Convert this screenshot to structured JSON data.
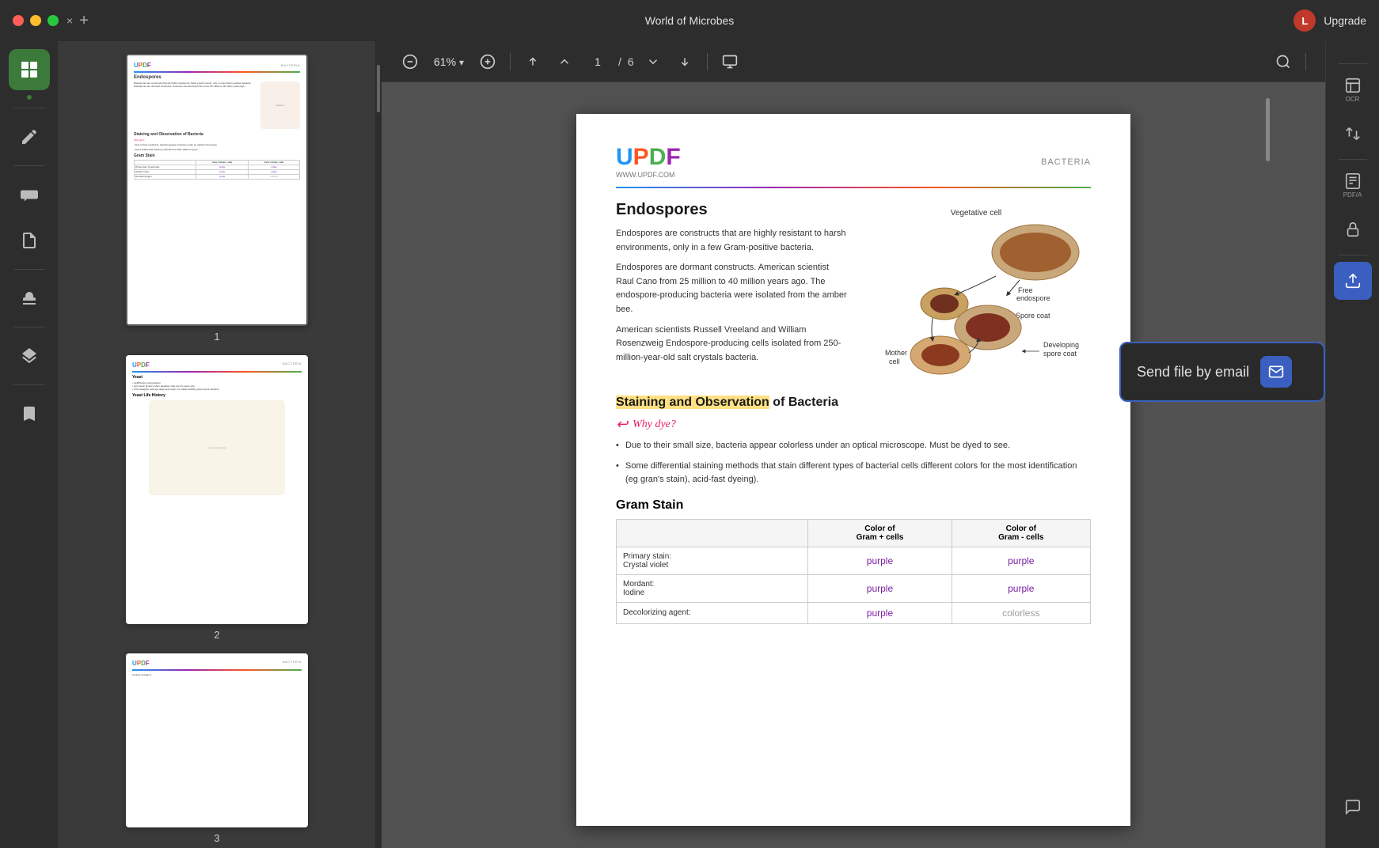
{
  "titlebar": {
    "title": "World of Microbes",
    "close_btn": "×",
    "add_btn": "+",
    "upgrade_label": "Upgrade",
    "avatar_letter": "L"
  },
  "toolbar": {
    "zoom_level": "61%",
    "zoom_dropdown": "▾",
    "page_current": "1",
    "page_separator": "/",
    "page_total": "6"
  },
  "left_sidebar": {
    "icons": [
      {
        "name": "thumbnail-icon",
        "label": "",
        "active": true
      },
      {
        "name": "pen-icon",
        "label": ""
      },
      {
        "name": "comment-icon",
        "label": ""
      },
      {
        "name": "organize-icon",
        "label": ""
      },
      {
        "name": "stamp-icon",
        "label": ""
      },
      {
        "name": "layers-icon",
        "label": ""
      },
      {
        "name": "bookmark-icon",
        "label": ""
      }
    ]
  },
  "right_sidebar": {
    "icons": [
      {
        "name": "ocr-icon",
        "label": "OCR"
      },
      {
        "name": "convert-icon",
        "label": ""
      },
      {
        "name": "pdf-ai-icon",
        "label": "PDF/A"
      },
      {
        "name": "secure-icon",
        "label": ""
      },
      {
        "name": "share-icon",
        "label": ""
      },
      {
        "name": "chat-icon",
        "label": ""
      }
    ]
  },
  "send_file_tooltip": {
    "text": "Send file by email",
    "icon": "✉"
  },
  "pdf_page": {
    "header": {
      "logo": "UPDF",
      "url": "WWW.UPDF.COM",
      "bacteria_label": "BACTERIA"
    },
    "endospores": {
      "title": "Endospores",
      "para1": "Endospores are constructs that are highly resistant to harsh environments, only in a few Gram-positive bacteria.",
      "para2": "Endospores are dormant constructs. American scientist Raul Cano from 25 million to 40 million years ago. The endospore-producing bacteria were isolated from the amber bee.",
      "para3": "American scientists Russell Vreeland and William Rosenzweig Endospore-producing cells isolated from 250-million-year-old salt crystals bacteria."
    },
    "staining": {
      "title": "Staining and Observation of Bacteria",
      "highlight_text": "Staining and Observation",
      "cursive": "Why dye?",
      "bullets": [
        "Due to their small size, bacteria appear colorless under an optical microscope. Must be dyed to see.",
        "Some differential staining methods that stain different types of bacterial cells different colors for the most identification (eg gran's stain), acid-fast dyeing)."
      ]
    },
    "gram_stain": {
      "title": "Gram Stain",
      "columns": [
        "",
        "Color of\nGram + cells",
        "Color of\nGram - cells"
      ],
      "rows": [
        {
          "label": "Primary stain:\nCrystal violet",
          "gram_pos": "purple",
          "gram_neg": "purple"
        },
        {
          "label": "Mordant:\nIodine",
          "gram_pos": "purple",
          "gram_neg": "purple"
        },
        {
          "label": "Decolorizing agent:",
          "gram_pos": "purple",
          "gram_neg": "colorless"
        }
      ]
    },
    "diagram_labels": {
      "vegetative_cell": "Vegetative cell",
      "free_endospore": "Free\nendospore",
      "spore_coat": "Spore coat",
      "developing_spore_coat": "Developing\nspore coat",
      "mother_cell": "Mother\ncell"
    }
  },
  "thumbnails": [
    {
      "page_num": "1",
      "has_table": true
    },
    {
      "page_num": "2",
      "has_diagram": true
    },
    {
      "page_num": "3",
      "has_content": true
    }
  ]
}
